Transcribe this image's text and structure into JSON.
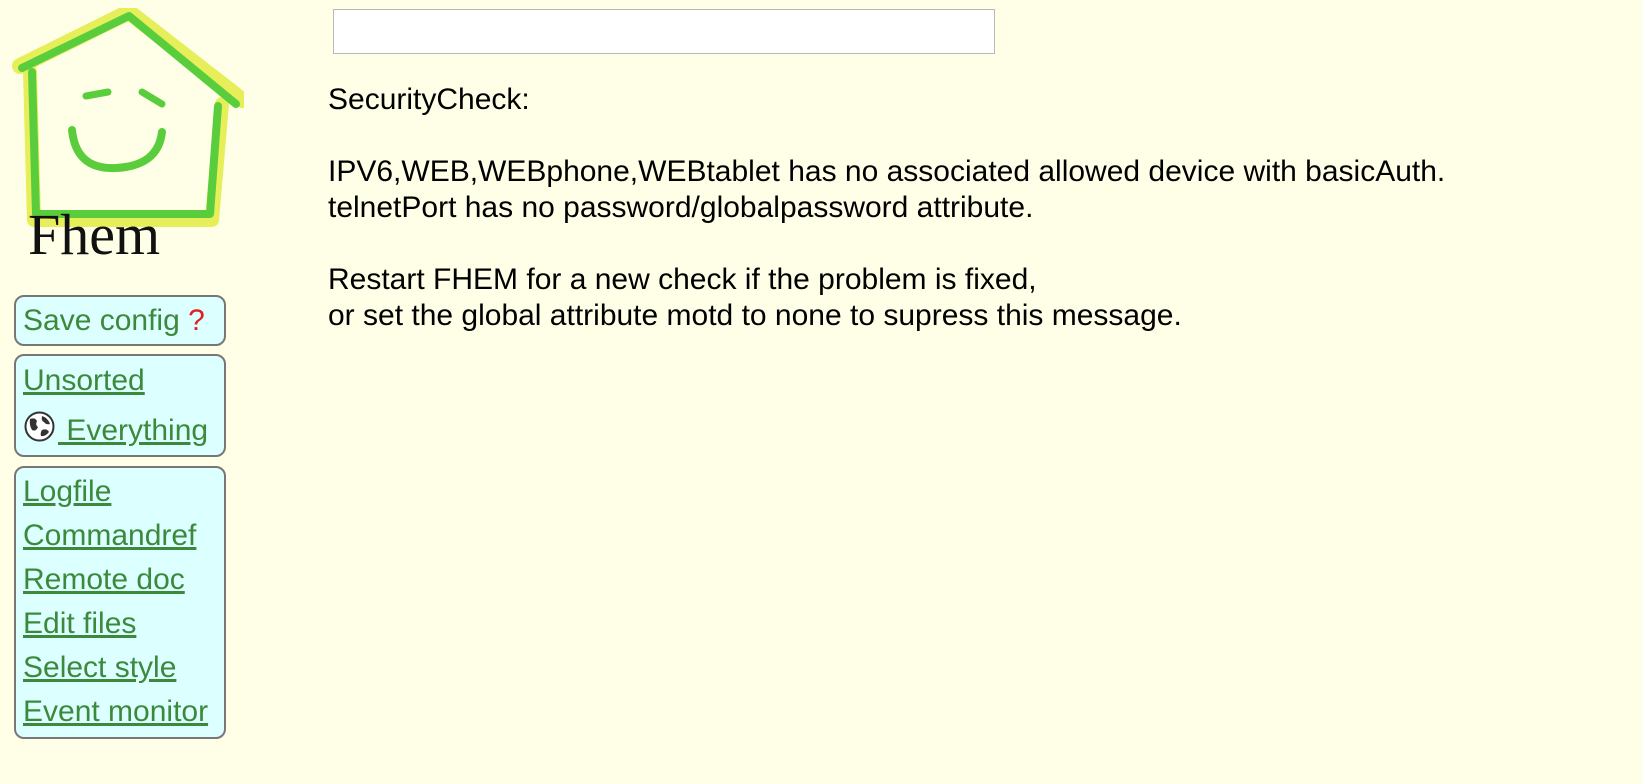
{
  "logo": {
    "text": "Fhem",
    "house_green": "#5acd3c",
    "house_yellow": "#e6ee5a",
    "face_green": "#5acd3c"
  },
  "command": {
    "value": "",
    "placeholder": ""
  },
  "menu": {
    "save_label": "Save config",
    "save_marker": "?",
    "rooms": [
      {
        "label": "Unsorted"
      },
      {
        "label": " Everything",
        "icon": "globe-icon"
      }
    ],
    "tools": [
      {
        "label": "Logfile"
      },
      {
        "label": "Commandref"
      },
      {
        "label": "Remote doc"
      },
      {
        "label": "Edit files"
      },
      {
        "label": "Select style"
      },
      {
        "label": "Event monitor"
      }
    ]
  },
  "motd": {
    "title": "SecurityCheck:",
    "line1": "IPV6,WEB,WEBphone,WEBtablet has no associated allowed device with basicAuth.",
    "line2": "telnetPort has no password/globalpassword attribute.",
    "line3": "Restart FHEM for a new check if the problem is fixed,",
    "line4": "or set the global attribute motd to none to supress this message."
  },
  "colors": {
    "background": "#ffffe7",
    "menu_background": "#dcffff",
    "link": "#3b8a3b",
    "alert": "#e02020"
  }
}
